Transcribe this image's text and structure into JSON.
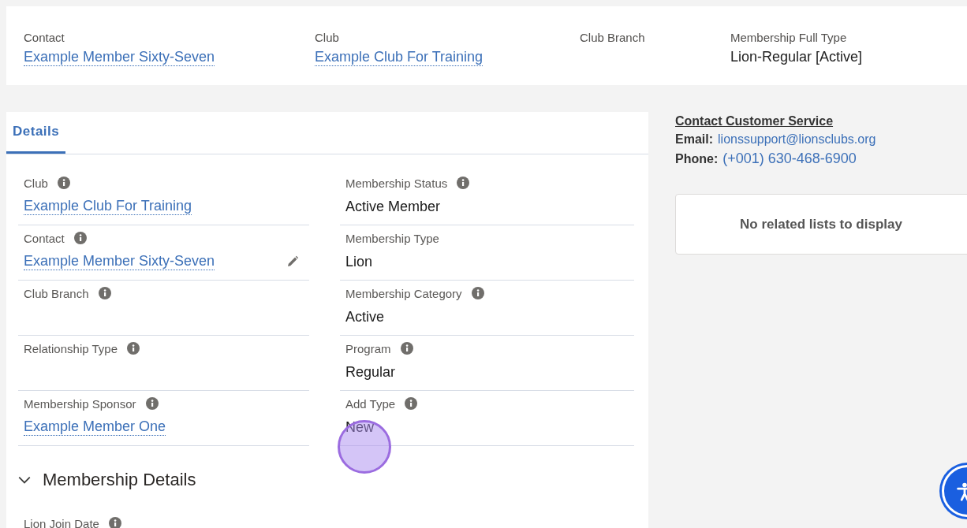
{
  "highlights": [
    {
      "label": "Contact",
      "value": "Example Member Sixty-Seven",
      "kind": "link"
    },
    {
      "label": "Club",
      "value": "Example Club For Training",
      "kind": "link"
    },
    {
      "label": "Club Branch"
    },
    {
      "label": "Membership Full Type",
      "value": "Lion-Regular [Active]",
      "kind": "text"
    }
  ],
  "tabs": [
    {
      "label": "Details",
      "selected": true
    }
  ],
  "fields": [
    {
      "label": "Club",
      "info": true,
      "value": "Example Club For Training",
      "kind": "link",
      "editable": false
    },
    {
      "label": "Membership Status",
      "info": true,
      "value": "Active Member",
      "kind": "text",
      "editable": false
    },
    {
      "label": "Contact",
      "info": true,
      "value": "Example Member Sixty-Seven",
      "kind": "link",
      "editable": true
    },
    {
      "label": "Membership Type",
      "info": false,
      "value": "Lion",
      "kind": "text",
      "editable": false
    },
    {
      "label": "Club Branch",
      "info": true,
      "editable": false
    },
    {
      "label": "Membership Category",
      "info": true,
      "value": "Active",
      "kind": "text",
      "editable": false
    },
    {
      "label": "Relationship Type",
      "info": true,
      "editable": false
    },
    {
      "label": "Program",
      "info": true,
      "value": "Regular",
      "kind": "text",
      "editable": false
    },
    {
      "label": "Membership Sponsor",
      "info": true,
      "value": "Example Member One",
      "kind": "link",
      "editable": false
    },
    {
      "label": "Add Type",
      "info": true,
      "value": "New",
      "kind": "text",
      "editable": false
    }
  ],
  "section": {
    "title": "Membership Details",
    "expanded": true,
    "fields": [
      {
        "label": "Lion Join Date",
        "info": true
      }
    ]
  },
  "customer_service": {
    "title": "Contact Customer Service",
    "email_label": "Email:",
    "email": "lionssupport@lionsclubs.org",
    "phone_label": "Phone:",
    "phone": "(+001) 630-468-6900"
  },
  "related": {
    "message": "No related lists to display"
  }
}
